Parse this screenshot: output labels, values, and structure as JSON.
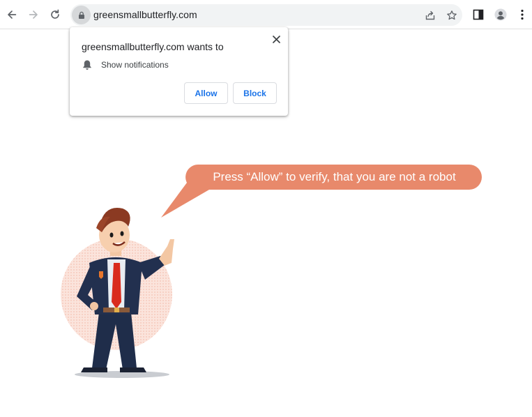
{
  "browser": {
    "url": "greensmallbutterfly.com",
    "icons": {
      "back": "arrow-left-icon",
      "forward": "arrow-right-icon",
      "reload": "reload-icon",
      "site_info": "lock-icon",
      "share": "share-icon",
      "bookmark": "star-icon",
      "side_panel": "side-panel-icon",
      "profile": "profile-icon",
      "menu": "kebab-menu-icon"
    }
  },
  "permission_prompt": {
    "title": "greensmallbutterfly.com wants to",
    "permission": "Show notifications",
    "allow_label": "Allow",
    "block_label": "Block",
    "accent_color": "#1a73e8"
  },
  "page": {
    "speech_bubble_text": "Press “Allow” to verify, that you are not a robot",
    "bubble_color": "#e8896b",
    "illustration": "cartoon businessman pointing up"
  }
}
